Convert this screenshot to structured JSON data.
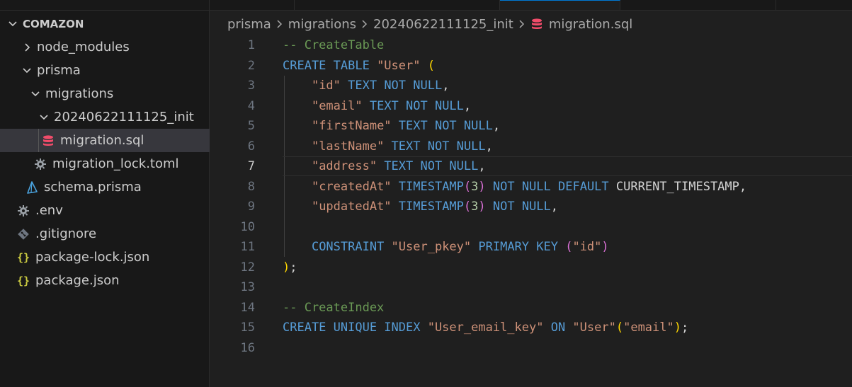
{
  "explorer": {
    "title": "COMAZON",
    "items": [
      {
        "label": "node_modules"
      },
      {
        "label": "prisma"
      },
      {
        "label": "migrations"
      },
      {
        "label": "20240622111125_init"
      },
      {
        "label": "migration.sql"
      },
      {
        "label": "migration_lock.toml"
      },
      {
        "label": "schema.prisma"
      },
      {
        "label": ".env"
      },
      {
        "label": ".gitignore"
      },
      {
        "label": "package-lock.json"
      },
      {
        "label": "package.json"
      }
    ]
  },
  "breadcrumb": {
    "parts": [
      "prisma",
      "migrations",
      "20240622111125_init",
      "migration.sql"
    ]
  },
  "editor": {
    "active_line": 7,
    "lines": [
      {
        "n": "1",
        "t": [
          [
            "cm",
            "-- CreateTable"
          ]
        ]
      },
      {
        "n": "2",
        "t": [
          [
            "kw",
            "CREATE TABLE "
          ],
          [
            "str",
            "\"User\""
          ],
          [
            "plain",
            " "
          ],
          [
            "p1",
            "("
          ]
        ]
      },
      {
        "n": "3",
        "t": [
          [
            "plain",
            "    "
          ],
          [
            "str",
            "\"id\""
          ],
          [
            "kw",
            " TEXT NOT NULL"
          ],
          [
            "plain",
            ","
          ]
        ]
      },
      {
        "n": "4",
        "t": [
          [
            "plain",
            "    "
          ],
          [
            "str",
            "\"email\""
          ],
          [
            "kw",
            " TEXT NOT NULL"
          ],
          [
            "plain",
            ","
          ]
        ]
      },
      {
        "n": "5",
        "t": [
          [
            "plain",
            "    "
          ],
          [
            "str",
            "\"firstName\""
          ],
          [
            "kw",
            " TEXT NOT NULL"
          ],
          [
            "plain",
            ","
          ]
        ]
      },
      {
        "n": "6",
        "t": [
          [
            "plain",
            "    "
          ],
          [
            "str",
            "\"lastName\""
          ],
          [
            "kw",
            " TEXT NOT NULL"
          ],
          [
            "plain",
            ","
          ]
        ]
      },
      {
        "n": "7",
        "t": [
          [
            "plain",
            "    "
          ],
          [
            "str",
            "\"address\""
          ],
          [
            "kw",
            " TEXT NOT NULL"
          ],
          [
            "plain",
            ","
          ]
        ]
      },
      {
        "n": "8",
        "t": [
          [
            "plain",
            "    "
          ],
          [
            "str",
            "\"createdAt\""
          ],
          [
            "kw",
            " TIMESTAMP"
          ],
          [
            "p2",
            "("
          ],
          [
            "num",
            "3"
          ],
          [
            "p2",
            ")"
          ],
          [
            "kw",
            " NOT NULL DEFAULT"
          ],
          [
            "plain",
            " CURRENT_TIMESTAMP,"
          ]
        ]
      },
      {
        "n": "9",
        "t": [
          [
            "plain",
            "    "
          ],
          [
            "str",
            "\"updatedAt\""
          ],
          [
            "kw",
            " TIMESTAMP"
          ],
          [
            "p2",
            "("
          ],
          [
            "num",
            "3"
          ],
          [
            "p2",
            ")"
          ],
          [
            "kw",
            " NOT NULL"
          ],
          [
            "plain",
            ","
          ]
        ]
      },
      {
        "n": "10",
        "t": []
      },
      {
        "n": "11",
        "t": [
          [
            "plain",
            "    "
          ],
          [
            "kw",
            "CONSTRAINT "
          ],
          [
            "str",
            "\"User_pkey\""
          ],
          [
            "kw",
            " PRIMARY KEY "
          ],
          [
            "p2",
            "("
          ],
          [
            "str",
            "\"id\""
          ],
          [
            "p2",
            ")"
          ]
        ]
      },
      {
        "n": "12",
        "t": [
          [
            "p1",
            ")"
          ],
          [
            "plain",
            ";"
          ]
        ]
      },
      {
        "n": "13",
        "t": []
      },
      {
        "n": "14",
        "t": [
          [
            "cm",
            "-- CreateIndex"
          ]
        ]
      },
      {
        "n": "15",
        "t": [
          [
            "kw",
            "CREATE UNIQUE INDEX "
          ],
          [
            "str",
            "\"User_email_key\""
          ],
          [
            "kw",
            " ON "
          ],
          [
            "str",
            "\"User\""
          ],
          [
            "p1",
            "("
          ],
          [
            "str",
            "\"email\""
          ],
          [
            "p1",
            ")"
          ],
          [
            "plain",
            ";"
          ]
        ]
      },
      {
        "n": "16",
        "t": []
      }
    ]
  },
  "colors": {
    "keyword": "#569cd6",
    "string": "#ce9178",
    "comment": "#6a9955",
    "number": "#b5cea8",
    "selection": "#37373d"
  }
}
